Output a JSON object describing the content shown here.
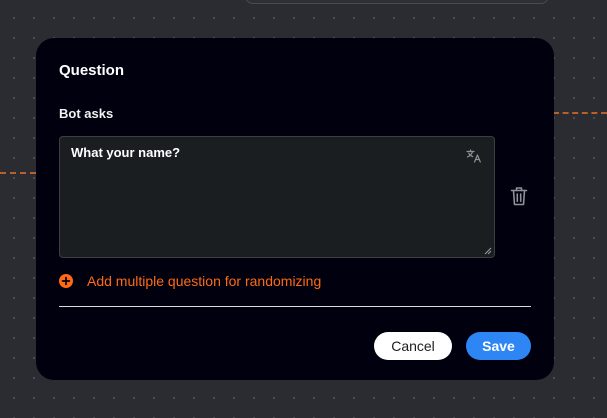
{
  "modal": {
    "title": "Question",
    "field_label": "Bot asks",
    "question_value": "What your name?",
    "add_link_label": "Add multiple question for randomizing",
    "cancel_label": "Cancel",
    "save_label": "Save"
  },
  "icons": {
    "translate": "translate-icon",
    "delete": "trash-icon",
    "add": "plus-circle-icon"
  },
  "colors": {
    "modal_background": "#00000f",
    "canvas_background": "#2b2c31",
    "accent_orange": "#ff6a13",
    "primary_blue": "#2e86f5",
    "connector": "#b85f2c"
  }
}
